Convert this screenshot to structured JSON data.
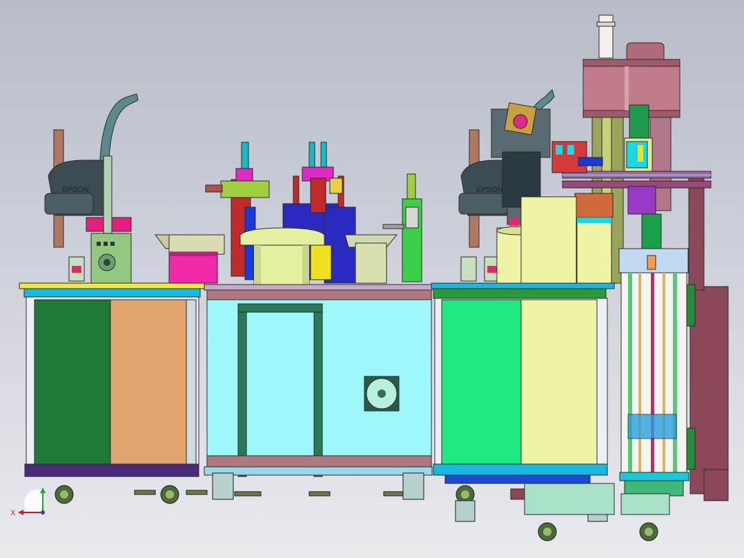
{
  "viewport": {
    "background_top": "#b7bcc8",
    "background_bottom": "#e9eaee"
  },
  "robots": [
    {
      "brand": "EPSON",
      "color": "#3d4c52"
    },
    {
      "brand": "EPSON",
      "color": "#3d4c52"
    }
  ],
  "triad": {
    "x_label": "X",
    "x_color": "#e01020",
    "y_color": "#10b030",
    "z_color": "#2040e0"
  },
  "colors": {
    "cabinet_left_a": "#1e7a36",
    "cabinet_left_b": "#e2a46e",
    "cabinet_mid": "#9cf8f8",
    "cabinet_right_a": "#1ee87e",
    "cabinet_right_b": "#eef4a4",
    "column": "#8a4858",
    "bowl_pink": "#f02aa8",
    "bowl_yellow": "#e4f0a0"
  }
}
